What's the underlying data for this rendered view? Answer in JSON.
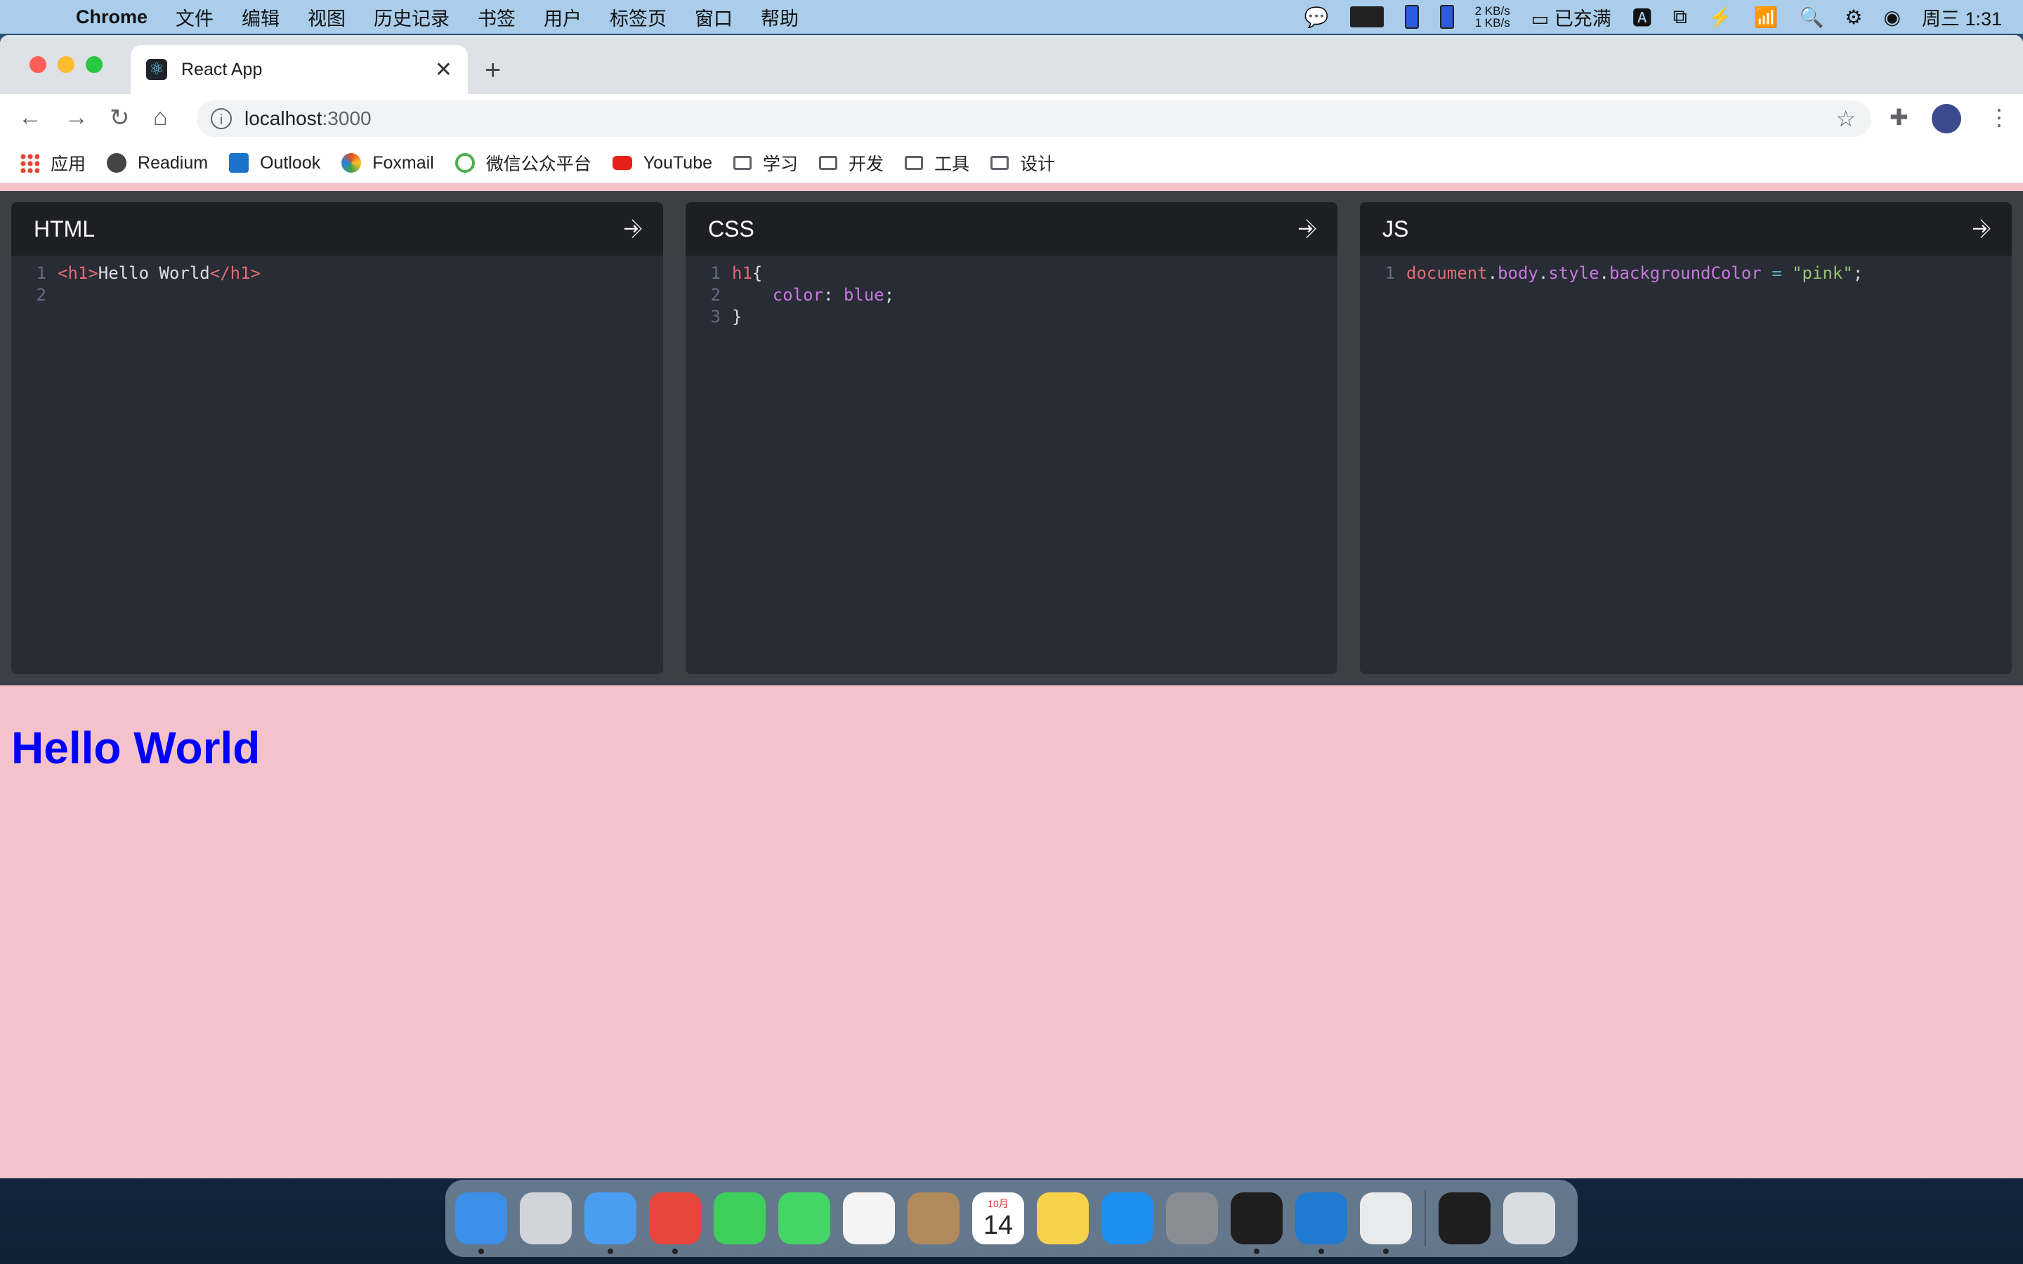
{
  "menubar": {
    "app_name": "Chrome",
    "items": [
      "文件",
      "编辑",
      "视图",
      "历史记录",
      "书签",
      "用户",
      "标签页",
      "窗口",
      "帮助"
    ],
    "net_up": "2 KB/s",
    "net_down": "1 KB/s",
    "battery_text": "已充满",
    "clock": "周三 1:31"
  },
  "browser": {
    "tab_title": "React App",
    "url_host": "localhost",
    "url_port": ":3000",
    "bookmarks": [
      "应用",
      "Readium",
      "Outlook",
      "Foxmail",
      "微信公众平台",
      "YouTube",
      "学习",
      "开发",
      "工具",
      "设计"
    ]
  },
  "editors": {
    "html": {
      "title": "HTML",
      "lines": [
        [
          {
            "t": "tag",
            "v": "<h1>"
          },
          {
            "t": "text",
            "v": "Hello World"
          },
          {
            "t": "tag",
            "v": "</h1>"
          }
        ],
        []
      ]
    },
    "css": {
      "title": "CSS",
      "lines": [
        [
          {
            "t": "tag",
            "v": "h1"
          },
          {
            "t": "text",
            "v": "{"
          }
        ],
        [
          {
            "t": "text",
            "v": "    "
          },
          {
            "t": "prop",
            "v": "color"
          },
          {
            "t": "text",
            "v": ": "
          },
          {
            "t": "prop",
            "v": "blue"
          },
          {
            "t": "text",
            "v": ";"
          }
        ],
        [
          {
            "t": "text",
            "v": "}"
          }
        ]
      ]
    },
    "js": {
      "title": "JS",
      "lines": [
        [
          {
            "t": "tag",
            "v": "document"
          },
          {
            "t": "text",
            "v": "."
          },
          {
            "t": "prop",
            "v": "body"
          },
          {
            "t": "text",
            "v": "."
          },
          {
            "t": "prop",
            "v": "style"
          },
          {
            "t": "text",
            "v": "."
          },
          {
            "t": "prop",
            "v": "backgroundColor"
          },
          {
            "t": "text",
            "v": " "
          },
          {
            "t": "op",
            "v": "="
          },
          {
            "t": "text",
            "v": " "
          },
          {
            "t": "str",
            "v": "\"pink\""
          },
          {
            "t": "text",
            "v": ";"
          }
        ]
      ]
    }
  },
  "preview": {
    "heading": "Hello World",
    "heading_color": "#0000ff",
    "background_color": "#f4c2cb"
  },
  "dock": {
    "apps": [
      {
        "name": "finder",
        "color": "#3d8fe8",
        "running": true
      },
      {
        "name": "launchpad",
        "color": "#d0d4db",
        "running": false
      },
      {
        "name": "mail",
        "color": "#4a9df0",
        "running": true
      },
      {
        "name": "chrome",
        "color": "#e8453c",
        "running": true
      },
      {
        "name": "facetime",
        "color": "#3ecf5a",
        "running": false
      },
      {
        "name": "messages",
        "color": "#45d466",
        "running": false
      },
      {
        "name": "photos",
        "color": "#f4f4f4",
        "running": false
      },
      {
        "name": "contacts",
        "color": "#b08a5a",
        "running": false
      },
      {
        "name": "calendar",
        "color": "#ffffff",
        "running": false,
        "month": "10月",
        "day": "14"
      },
      {
        "name": "notes",
        "color": "#f7d24a",
        "running": false
      },
      {
        "name": "app-store",
        "color": "#1d8ff0",
        "running": false
      },
      {
        "name": "system-preferences",
        "color": "#8a8d93",
        "running": false
      },
      {
        "name": "terminal",
        "color": "#1e1e1e",
        "running": true
      },
      {
        "name": "vscode",
        "color": "#1f7ad0",
        "running": true
      },
      {
        "name": "wechat",
        "color": "#e9eaec",
        "running": true
      }
    ],
    "extras": [
      {
        "name": "terminal-window",
        "color": "#1e1e1e"
      },
      {
        "name": "trash",
        "color": "#d9dde2"
      }
    ]
  }
}
